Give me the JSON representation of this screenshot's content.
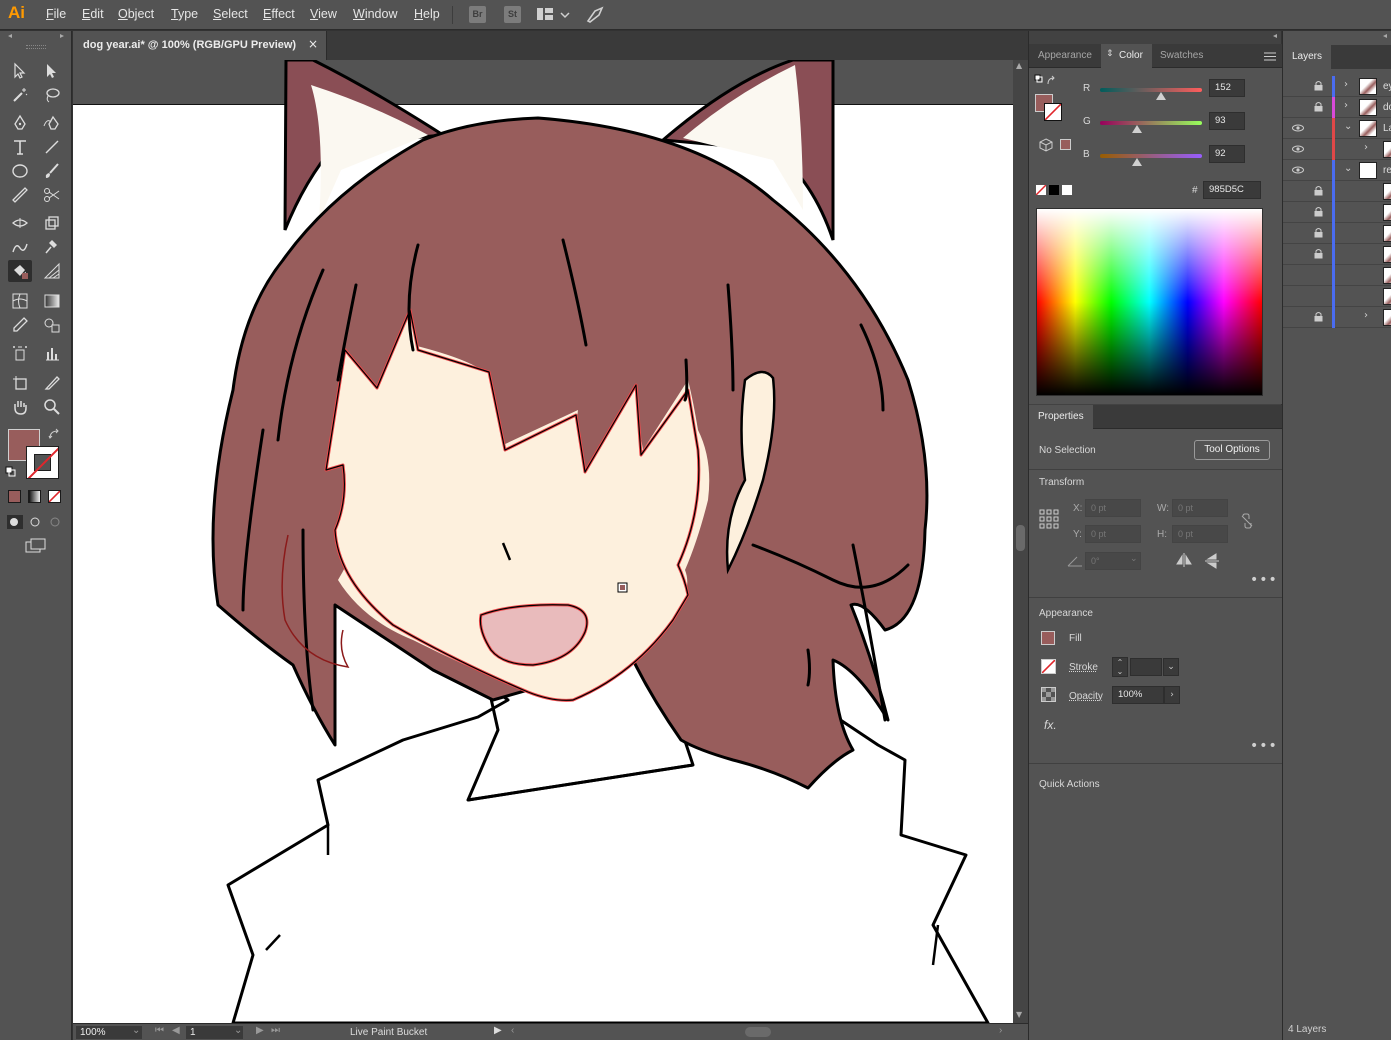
{
  "app": {
    "logo": "Ai",
    "menus": [
      "File",
      "Edit",
      "Object",
      "Type",
      "Select",
      "Effect",
      "View",
      "Window",
      "Help"
    ],
    "bridge_label": "Br",
    "stock_label": "St"
  },
  "document": {
    "tab_title": "dog year.ai* @ 100% (RGB/GPU Preview)",
    "close_glyph": "×"
  },
  "status": {
    "zoom": "100%",
    "artboard_number": "1",
    "current_tool": "Live Paint Bucket"
  },
  "colors": {
    "fill": "#985D5C",
    "hair": "#985D5C",
    "skin": "#FDF0DD",
    "mouth": "#E9BBBC",
    "selection_highlight": "#F0494B",
    "ear_inner": "#FBF8F1",
    "ear_dark": "#8A4E55"
  },
  "color_panel": {
    "tabs": [
      "Appearance",
      "Color",
      "Swatches"
    ],
    "active_tab": "Color",
    "r_label": "R",
    "g_label": "G",
    "b_label": "B",
    "r_value": "152",
    "g_value": "93",
    "b_value": "92",
    "hex_prefix": "#",
    "hex_value": "985D5C"
  },
  "properties_panel": {
    "tab": "Properties",
    "selection_status": "No Selection",
    "tool_options_button": "Tool Options",
    "transform": {
      "title": "Transform",
      "x_label": "X:",
      "x_placeholder": "0 pt",
      "y_label": "Y:",
      "y_placeholder": "0 pt",
      "w_label": "W:",
      "w_placeholder": "0 pt",
      "h_label": "H:",
      "h_placeholder": "0 pt",
      "angle_placeholder": "0°"
    },
    "appearance": {
      "title": "Appearance",
      "fill_label": "Fill",
      "stroke_label": "Stroke",
      "opacity_label": "Opacity",
      "opacity_value": "100%",
      "fx_label": "fx."
    },
    "quick_actions": "Quick Actions"
  },
  "layers_panel": {
    "tab": "Layers",
    "count": "4 Layers",
    "rows": [
      {
        "name": "ey",
        "visible": false,
        "locked": true,
        "color": "#4a6cf0",
        "expand": "›"
      },
      {
        "name": "do",
        "visible": false,
        "locked": true,
        "color": "#d94ad9",
        "expand": "›"
      },
      {
        "name": "La",
        "visible": true,
        "locked": false,
        "color": "#e04848",
        "expand": "⌄"
      },
      {
        "name": "",
        "visible": true,
        "locked": false,
        "color": "#e04848",
        "expand": "›"
      },
      {
        "name": "re",
        "visible": true,
        "locked": false,
        "color": "#4a6cf0",
        "expand": "⌄"
      },
      {
        "name": "",
        "visible": false,
        "locked": true,
        "color": "#4a6cf0",
        "expand": ""
      },
      {
        "name": "",
        "visible": false,
        "locked": true,
        "color": "#4a6cf0",
        "expand": ""
      },
      {
        "name": "",
        "visible": false,
        "locked": true,
        "color": "#4a6cf0",
        "expand": ""
      },
      {
        "name": "",
        "visible": false,
        "locked": true,
        "color": "#4a6cf0",
        "expand": ""
      },
      {
        "name": "",
        "visible": false,
        "locked": false,
        "color": "#4a6cf0",
        "expand": ""
      },
      {
        "name": "",
        "visible": false,
        "locked": false,
        "color": "#4a6cf0",
        "expand": ""
      },
      {
        "name": "",
        "visible": false,
        "locked": true,
        "color": "#4a6cf0",
        "expand": "›"
      }
    ]
  }
}
